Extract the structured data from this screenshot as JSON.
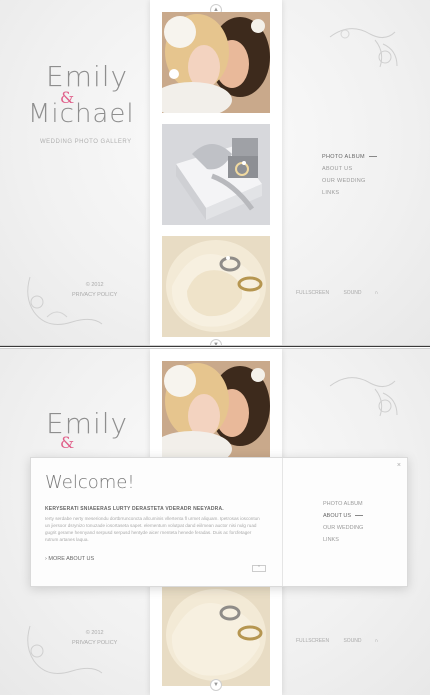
{
  "site": {
    "name_first": "Emily",
    "name_second": "Michael",
    "heart_glyph": "&",
    "subtitle": "WEDDING PHOTO GALLERY",
    "copyright": "© 2012",
    "privacy": "PRIVACY POLICY"
  },
  "nav": {
    "items": [
      "PHOTO ALBUM",
      "ABOUT US",
      "OUR WEDDING",
      "LINKS"
    ]
  },
  "controls": {
    "fullscreen": "FULLSCREEN",
    "sound": "SOUND"
  },
  "modal": {
    "title": "Welcome!",
    "heading": "KERYSERATI SNIAEERAS LURTY DERASTETA VDERADR NEEYADRA.",
    "body": "Ierty serdabe nerty meseriondu dortbrrunconcta allcuminis vllertenta fl urmet aliquam. Ipetrosas ioscontun un jiersoor dsrynizo tonuzade iosortaseta sapet. elementum volutpat dand eiilmean auctor nisi nulg ruad gugrit gerame hennyand serpusd serpusd hentyde aicer rnenteta henede feradas. Duis ac forcfetager rutrum artanes laqua.",
    "more": "MORE ABOUT US",
    "scroll_icon": "up-arrow",
    "close": "×"
  },
  "colors": {
    "accent": "#e0608a",
    "text": "#8e8e8e"
  }
}
